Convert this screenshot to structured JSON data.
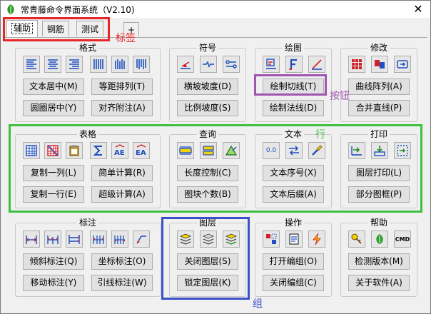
{
  "window": {
    "title": "常青藤命令界面系统（V2.10)",
    "close_glyph": "✕"
  },
  "tabs": [
    {
      "label": "辅助",
      "active": true
    },
    {
      "label": "钢筋",
      "active": false
    },
    {
      "label": "测试",
      "active": false
    }
  ],
  "tab_add": "+",
  "groups": {
    "geshi": {
      "title": "格式",
      "buttons": [
        "文本居中(M)",
        "等距排列(T)",
        "圆圈居中(Y)",
        "对齐附注(A)"
      ]
    },
    "fuhao": {
      "title": "符号",
      "buttons": [
        "横坡坡度(D)",
        "比例坡度(S)"
      ]
    },
    "huitu": {
      "title": "绘图",
      "buttons": [
        "绘制切线(T)",
        "绘制法线(D)"
      ]
    },
    "xiugai": {
      "title": "修改",
      "buttons": [
        "曲线阵列(A)",
        "合并直线(P)"
      ]
    },
    "biaoge": {
      "title": "表格",
      "buttons": [
        "复制一列(L)",
        "简单计算(R)",
        "复制一行(E)",
        "超级计算(A)"
      ]
    },
    "chaxun": {
      "title": "查询",
      "buttons": [
        "长度控制(C)",
        "图块个数(B)"
      ]
    },
    "wenben": {
      "title": "文本",
      "buttons": [
        "文本序号(X)",
        "文本后缀(A)"
      ],
      "icon_text": "0.0"
    },
    "dayin": {
      "title": "打印",
      "buttons": [
        "图层打印(L)",
        "部分图框(P)"
      ]
    },
    "biaozhu": {
      "title": "标注",
      "buttons": [
        "倾斜标注(Q)",
        "坐标标注(O)",
        "移动标注(Y)",
        "引线标注(W)"
      ]
    },
    "tuceng": {
      "title": "图层",
      "buttons": [
        "关闭图层(S)",
        "锁定图层(K)"
      ]
    },
    "caozuo": {
      "title": "操作",
      "buttons": [
        "打开编组(O)",
        "关闭编组(C)"
      ]
    },
    "bangzhu": {
      "title": "帮助",
      "buttons": [
        "检测版本(M)",
        "关于软件(A)"
      ],
      "icon_text": "CMD"
    }
  },
  "annotations": {
    "tab_label": "标签",
    "tab_color": "#e8262a",
    "button_label": "按钮",
    "button_color": "#a056b0",
    "row_label": "行",
    "row_color": "#3fbf3f",
    "group_label": "组",
    "group_color": "#3a4fc8"
  }
}
